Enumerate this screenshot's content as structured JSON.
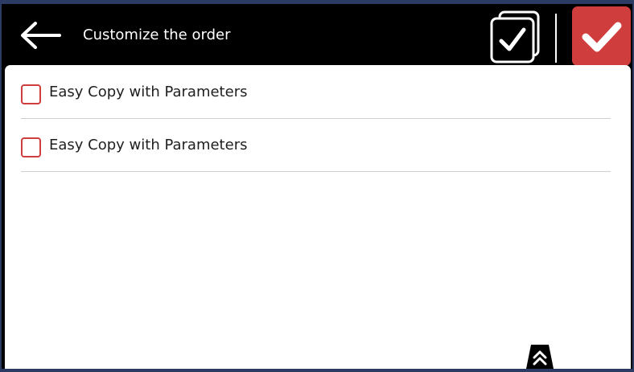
{
  "header": {
    "title": "Customize the order",
    "back_icon": "arrow-left-icon",
    "select_all_icon": "multi-checkbox-icon",
    "confirm_icon": "checkmark-icon"
  },
  "colors": {
    "header_bg": "#000000",
    "accent": "#cf3d3d",
    "panel_bg": "#ffffff",
    "frame": "#2c3b63"
  },
  "items": [
    {
      "label": "Easy Copy with Parameters",
      "checked": false
    },
    {
      "label": "Easy Copy with Parameters",
      "checked": false
    }
  ],
  "scroll": {
    "icon": "double-chevron-up-icon"
  }
}
